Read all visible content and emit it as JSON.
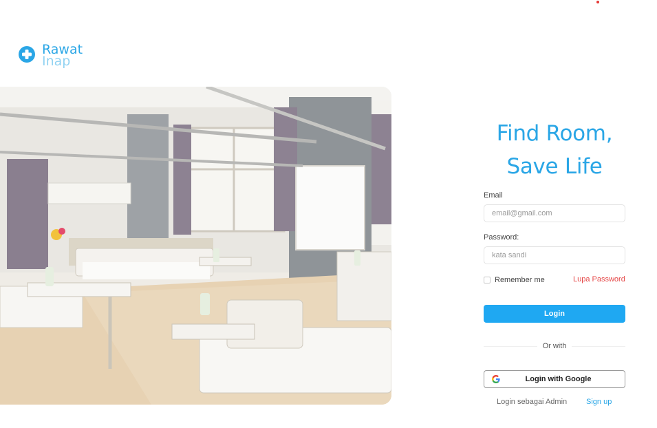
{
  "brand": {
    "name_line1": "Rawat",
    "name_line2": "Inap",
    "primary_color": "#2aa6e6",
    "secondary_color": "#93d3f2"
  },
  "hero": {
    "icon": "hospital-ward-image"
  },
  "headline": {
    "line1": "Find Room,",
    "line2": "Save Life"
  },
  "form": {
    "email_label": "Email",
    "email_placeholder": "email@gmail.com",
    "password_label": "Password:",
    "password_placeholder": "kata sandi",
    "remember_label": "Remember me",
    "forgot_label": "Lupa Password",
    "login_label": "Login",
    "divider_label": "Or with",
    "google_label": "Login with Google",
    "admin_label": "Login sebagai Admin",
    "signup_label": "Sign up"
  },
  "colors": {
    "accent": "#1fa8f2",
    "link_red": "#e54848"
  }
}
